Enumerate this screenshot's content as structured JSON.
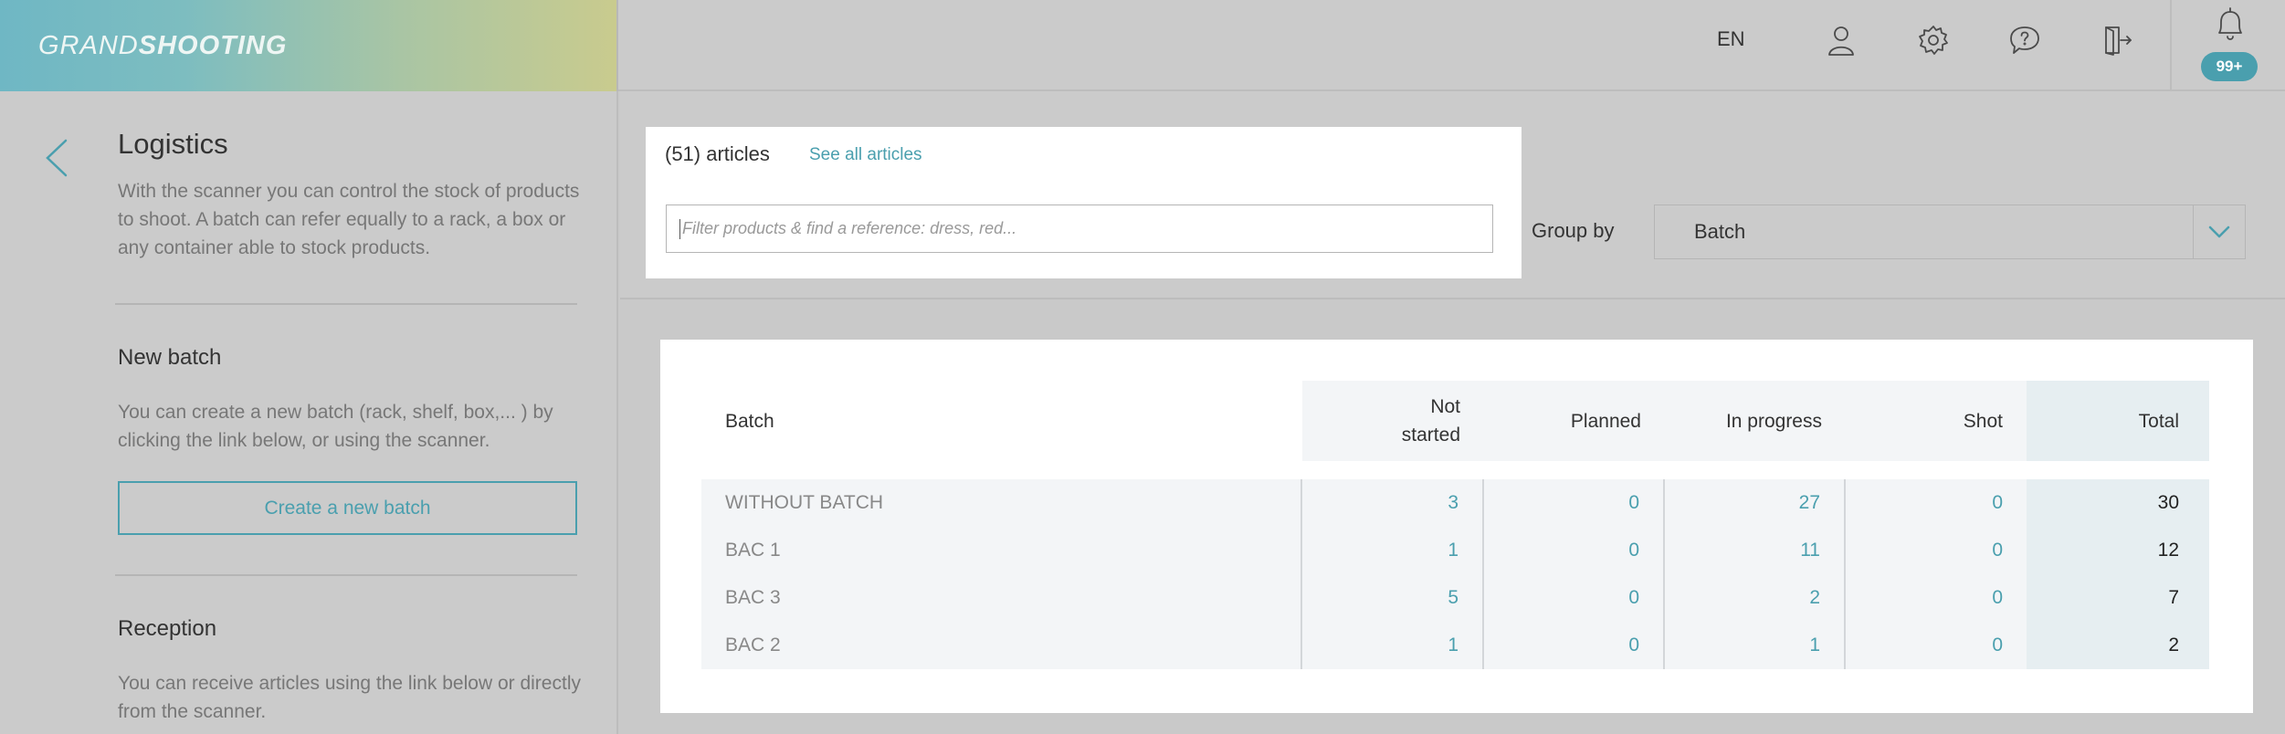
{
  "app": {
    "logo_light": "GRAND",
    "logo_bold": "SHOOTING",
    "language": "EN",
    "notifications_badge": "99+"
  },
  "icons": {
    "user": "user-icon",
    "settings": "gear-icon",
    "help": "help-icon",
    "logout": "logout-icon",
    "notifications": "bell-icon",
    "back": "chevron-left-icon",
    "dropdown": "chevron-down-icon"
  },
  "colors": {
    "accent": "#4a9fae",
    "background": "#cbcbcb",
    "panel": "#ffffff"
  },
  "sidebar": {
    "title": "Logistics",
    "description": "With the scanner you can control the stock of products to shoot. A batch can refer equally to a rack, a box or any container able to stock products.",
    "new_batch": {
      "title": "New batch",
      "description": "You can create a new batch (rack, shelf, box,... ) by clicking the link below, or using the scanner.",
      "button": "Create a new batch"
    },
    "reception": {
      "title": "Reception",
      "description": "You can receive articles using the link below or directly from the scanner."
    }
  },
  "filter": {
    "article_count": "(51) articles",
    "see_all": "See all articles",
    "placeholder": "Filter products & find a reference: dress, red...",
    "group_by_label": "Group by",
    "group_by_value": "Batch"
  },
  "table": {
    "headers": {
      "batch": "Batch",
      "not_started_1": "Not",
      "not_started_2": "started",
      "planned": "Planned",
      "in_progress": "In progress",
      "shot": "Shot",
      "total": "Total"
    },
    "rows": [
      {
        "batch": "WITHOUT BATCH",
        "not_started": "3",
        "planned": "0",
        "in_progress": "27",
        "shot": "0",
        "total": "30"
      },
      {
        "batch": "BAC 1",
        "not_started": "1",
        "planned": "0",
        "in_progress": "11",
        "shot": "0",
        "total": "12"
      },
      {
        "batch": "BAC 3",
        "not_started": "5",
        "planned": "0",
        "in_progress": "2",
        "shot": "0",
        "total": "7"
      },
      {
        "batch": "BAC 2",
        "not_started": "1",
        "planned": "0",
        "in_progress": "1",
        "shot": "0",
        "total": "2"
      }
    ]
  }
}
